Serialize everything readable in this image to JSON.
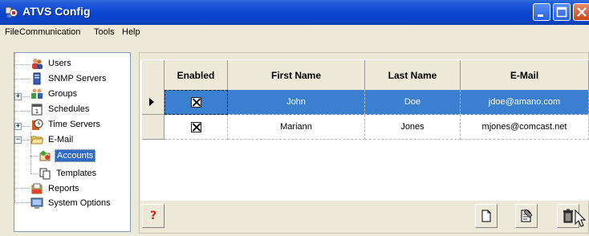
{
  "window": {
    "title": "ATVS Config",
    "colors": {
      "titlebar": "#0a45cf",
      "selection": "#316ac5",
      "row_selected": "#3b7fd0"
    }
  },
  "menu": [
    "File",
    "Communication",
    "Tools",
    "Help"
  ],
  "tree": {
    "items": [
      {
        "label": "Users",
        "icon": "users-icon"
      },
      {
        "label": "SNMP Servers",
        "icon": "server-icon"
      },
      {
        "label": "Groups",
        "icon": "groups-icon"
      },
      {
        "label": "Schedules",
        "icon": "calendar-icon"
      },
      {
        "label": "Time Servers",
        "icon": "time-server-icon"
      },
      {
        "label": "E-Mail",
        "icon": "folder-open-icon"
      },
      {
        "label": "Accounts",
        "icon": "mail-accounts-icon",
        "selected": true
      },
      {
        "label": "Templates",
        "icon": "templates-icon"
      },
      {
        "label": "Reports",
        "icon": "reports-icon"
      },
      {
        "label": "System Options",
        "icon": "monitor-icon"
      }
    ]
  },
  "grid": {
    "columns": [
      "Enabled",
      "First Name",
      "Last Name",
      "E-Mail"
    ],
    "rows": [
      {
        "enabled": true,
        "first": "John",
        "last": "Doe",
        "email": "jdoe@amano.com",
        "selected": true
      },
      {
        "enabled": true,
        "first": "Mariann",
        "last": "Jones",
        "email": "mjones@comcast.net",
        "selected": false
      }
    ]
  },
  "buttons": {
    "help": "?",
    "icons": [
      "help-icon",
      "new-document-icon",
      "edit-document-icon",
      "trash-icon"
    ]
  }
}
